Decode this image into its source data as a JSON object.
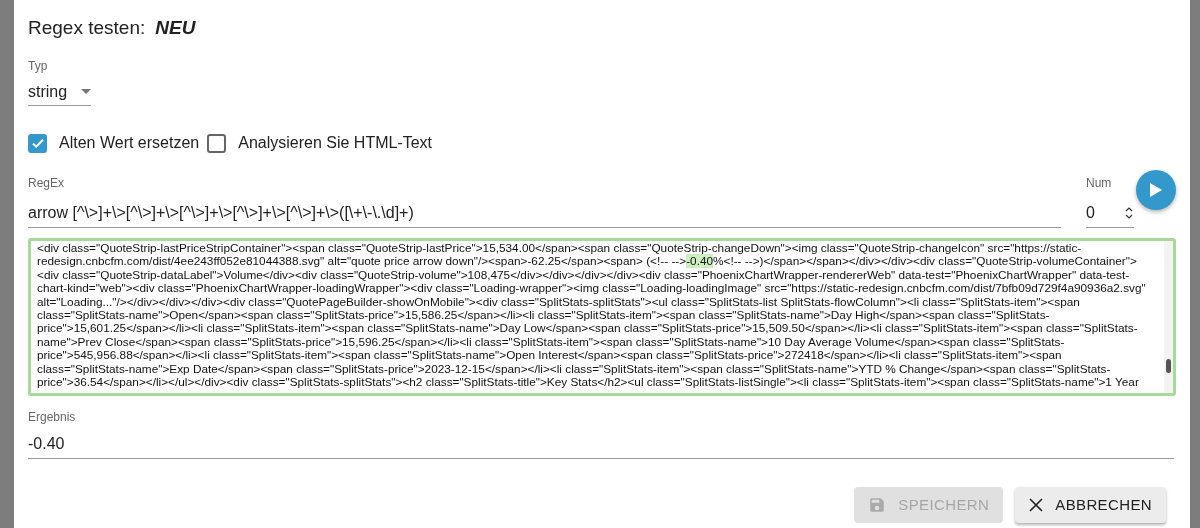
{
  "dialog": {
    "title": "Regex testen:",
    "title_value": "NEU"
  },
  "type_select": {
    "label": "Typ",
    "value": "string"
  },
  "checkboxes": [
    {
      "label": "Alten Wert ersetzen",
      "checked": true
    },
    {
      "label": "Analysieren Sie HTML-Text",
      "checked": false
    }
  ],
  "regex_field": {
    "label": "RegEx",
    "value": "arrow [^\\>]+\\>[^\\>]+\\>[^\\>]+\\>[^\\>]+\\>[^\\>]+\\>([\\+\\-\\.\\d]+)"
  },
  "num_field": {
    "label": "Num",
    "value": "0"
  },
  "test_text": {
    "lines": [
      {
        "text": "<div class=\"QuoteStrip-lastPriceStripContainer\"><span class=\"QuoteStrip-lastPrice\">15,534.00</span><span class=\"QuoteStrip-changeDown\"><img class=\"QuoteStrip-changeIcon\" src=\"https://static-"
      },
      {
        "text": "redesign.cnbcfm.com/dist/4ee243ff052e81044388.svg\" alt=\"quote price arrow down\"/><span>-62.25</span><span> (<!-- -->",
        "match": "-0.40",
        "after": "%<!-- -->)</span></span></div></div><div class=\"QuoteStrip-volumeContainer\">"
      },
      {
        "text": "<div class=\"QuoteStrip-dataLabel\">Volume</div><div class=\"QuoteStrip-volume\">108,475</div></div></div></div><div class=\"PhoenixChartWrapper-rendererWeb\" data-test=\"PhoenixChartWrapper\" data-test-"
      },
      {
        "text": "chart-kind=\"web\"><div class=\"PhoenixChartWrapper-loadingWrapper\"><div class=\"Loading-wrapper\"><img class=\"Loading-loadingImage\" src=\"https://static-redesign.cnbcfm.com/dist/7bfb09d729f4a90936a2.svg\""
      },
      {
        "text": "alt=\"Loading...\"/></div></div></div><div class=\"QuotePageBuilder-showOnMobile\"><div class=\"SplitStats-splitStats\"><ul class=\"SplitStats-list SplitStats-flowColumn\"><li class=\"SplitStats-item\"><span"
      },
      {
        "text": "class=\"SplitStats-name\">Open</span><span class=\"SplitStats-price\">15,586.25</span></li><li class=\"SplitStats-item\"><span class=\"SplitStats-name\">Day High</span><span class=\"SplitStats-"
      },
      {
        "text": "price\">15,601.25</span></li><li class=\"SplitStats-item\"><span class=\"SplitStats-name\">Day Low</span><span class=\"SplitStats-price\">15,509.50</span></li><li class=\"SplitStats-item\"><span class=\"SplitStats-"
      },
      {
        "text": "name\">Prev Close</span><span class=\"SplitStats-price\">15,596.25</span></li><li class=\"SplitStats-item\"><span class=\"SplitStats-name\">10 Day Average Volume</span><span class=\"SplitStats-"
      },
      {
        "text": "price\">545,956.88</span></li><li class=\"SplitStats-item\"><span class=\"SplitStats-name\">Open Interest</span><span class=\"SplitStats-price\">272418</span></li><li class=\"SplitStats-item\"><span"
      },
      {
        "text": "class=\"SplitStats-name\">Exp Date</span><span class=\"SplitStats-price\">2023-12-15</span></li><li class=\"SplitStats-item\"><span class=\"SplitStats-name\">YTD % Change</span><span class=\"SplitStats-"
      },
      {
        "text": "price\">36.54</span></li></ul></div><div class=\"SplitStats-splitStats\"><h2 class=\"SplitStats-title\">Key Stats</h2><ul class=\"SplitStats-listSingle\"><li class=\"SplitStats-item\"><span class=\"SplitStats-name\">1 Year"
      }
    ]
  },
  "result": {
    "label": "Ergebnis",
    "value": "-0.40"
  },
  "buttons": [
    {
      "kind": "save",
      "label": "SPEICHERN",
      "disabled": true
    },
    {
      "kind": "cancel",
      "label": "ABBRECHEN",
      "disabled": false
    }
  ]
}
